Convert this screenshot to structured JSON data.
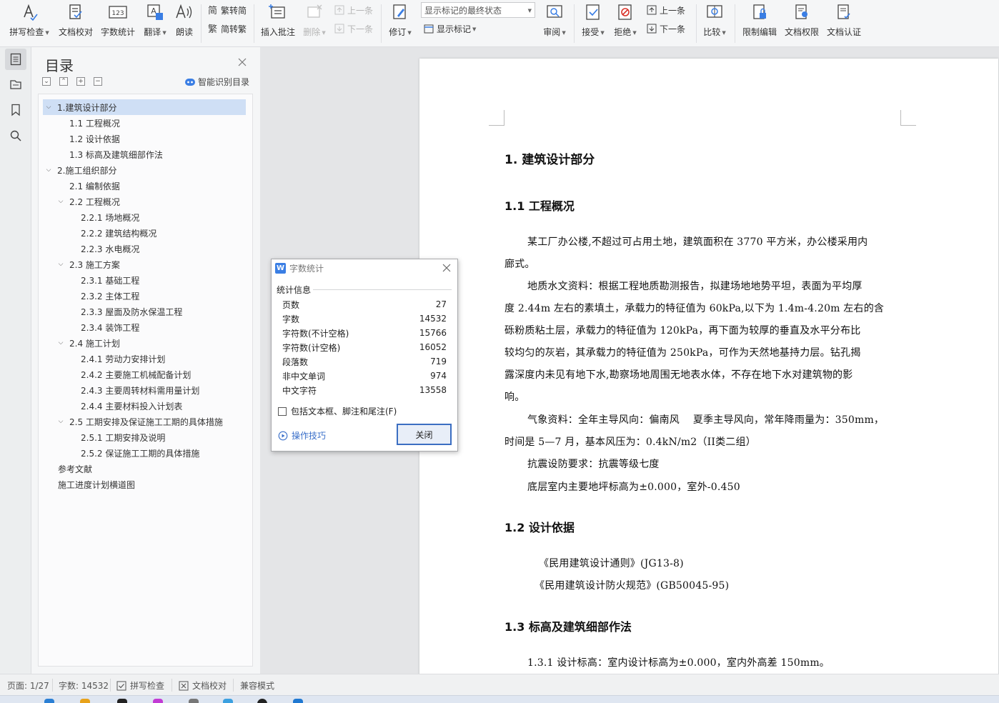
{
  "ribbon": {
    "spell_check": "拼写检查",
    "doc_proof": "文档校对",
    "word_count": "字数统计",
    "translate": "翻译",
    "read_aloud": "朗读",
    "to_traditional": "繁转简",
    "to_simplified": "简转繁",
    "insert_comment": "插入批注",
    "delete": "删除",
    "prev_comment": "上一条",
    "next_comment": "下一条",
    "revise": "修订",
    "markup_state": "显示标记的最终状态",
    "show_markup": "显示标记",
    "review": "审阅",
    "accept": "接受",
    "reject": "拒绝",
    "prev_change": "上一条",
    "next_change": "下一条",
    "compare": "比较",
    "restrict_edit": "限制编辑",
    "doc_permission": "文档权限",
    "doc_cert": "文档认证"
  },
  "toc": {
    "title": "目录",
    "smart_label": "智能识别目录",
    "items": [
      {
        "label": "1.建筑设计部分"
      },
      {
        "label": "1.1 工程概况"
      },
      {
        "label": "1.2 设计依据"
      },
      {
        "label": "1.3 标高及建筑细部作法"
      },
      {
        "label": "2.施工组织部分"
      },
      {
        "label": "2.1 编制依据"
      },
      {
        "label": "2.2 工程概况"
      },
      {
        "label": "2.2.1 场地概况"
      },
      {
        "label": "2.2.2 建筑结构概况"
      },
      {
        "label": "2.2.3 水电概况"
      },
      {
        "label": "2.3 施工方案"
      },
      {
        "label": "2.3.1 基础工程"
      },
      {
        "label": "2.3.2 主体工程"
      },
      {
        "label": "2.3.3 屋面及防水保温工程"
      },
      {
        "label": "2.3.4 装饰工程"
      },
      {
        "label": "2.4 施工计划"
      },
      {
        "label": "2.4.1  劳动力安排计划"
      },
      {
        "label": "2.4.2  主要施工机械配备计划"
      },
      {
        "label": "2.4.3  主要周转材料需用量计划"
      },
      {
        "label": "2.4.4  主要材料投入计划表"
      },
      {
        "label": "2.5 工期安排及保证施工工期的具体措施"
      },
      {
        "label": "2.5.1 工期安排及说明"
      },
      {
        "label": "2.5.2  保证施工工期的具体措施"
      },
      {
        "label": "参考文献"
      },
      {
        "label": "施工进度计划横道图"
      }
    ]
  },
  "document": {
    "h_1": "1. 建筑设计部分",
    "h_1_1": "1.1 工程概况",
    "p1_l1": "某工厂办公楼,不超过可占用土地，建筑面积在 3770 平方米，办公楼采用内",
    "p1_l2": "廊式。",
    "p2_l1": "地质水文资料：根据工程地质勘测报告，拟建场地地势平坦，表面为平均厚",
    "p2_l2": "度 2.44m 左右的素填土，承载力的特征值为 60kPa,以下为 1.4m-4.20m 左右的含",
    "p2_l3": "砾粉质粘土层，承载力的特征值为 120kPa，再下面为较厚的垂直及水平分布比",
    "p2_l4": "较均匀的灰岩，其承载力的特征值为 250kPa，可作为天然地基持力层。钻孔揭",
    "p2_l5": "露深度内未见有地下水,勘察场地周围无地表水体，不存在地下水对建筑物的影",
    "p2_l6": "响。",
    "p3_l1": "气象资料：全年主导风向：偏南风　 夏季主导风向，常年降雨量为：350mm，",
    "p3_l2": "时间是 5—7 月，基本风压为：0.4kN/m2（II类二组）",
    "p4": "抗震设防要求：抗震等级七度",
    "p5": "底层室内主要地坪标高为±0.000，室外-0.450",
    "h_1_2": "1.2 设计依据",
    "ref1": "《民用建筑设计通则》(JG13-8)",
    "ref2": "《民用建筑设计防火规范》(GB50045-95)",
    "h_1_3": "1.3 标高及建筑细部作法",
    "p6": "1.3.1 设计标高：室内设计标高为±0.000，室内外高差 150mm。"
  },
  "dialog": {
    "title": "字数统计",
    "group": "统计信息",
    "stats": [
      {
        "label": "页数",
        "value": "27"
      },
      {
        "label": "字数",
        "value": "14532"
      },
      {
        "label": "字符数(不计空格)",
        "value": "15766"
      },
      {
        "label": "字符数(计空格)",
        "value": "16052"
      },
      {
        "label": "段落数",
        "value": "719"
      },
      {
        "label": "非中文单词",
        "value": "974"
      },
      {
        "label": "中文字符",
        "value": "13558"
      }
    ],
    "include_label": "包括文本框、脚注和尾注(F)",
    "tips_label": "操作技巧",
    "close_label": "关闭"
  },
  "status": {
    "page": "页面: 1/27",
    "words": "字数: 14532",
    "spell": "拼写检查",
    "proof": "文档校对",
    "compat": "兼容模式"
  },
  "colors": {
    "accent": "#3b6ec2",
    "selection": "#cfdff5",
    "reject_red": "#d9342b"
  }
}
